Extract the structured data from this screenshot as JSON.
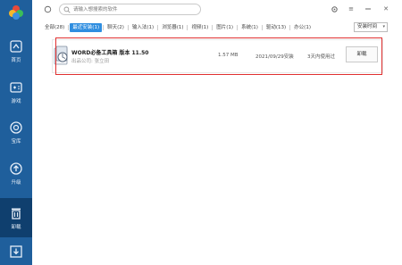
{
  "search": {
    "placeholder": "请输入想搜索的软件"
  },
  "sidebar": {
    "items": [
      {
        "label": "首页"
      },
      {
        "label": "游戏"
      },
      {
        "label": "宝库"
      },
      {
        "label": "升级"
      },
      {
        "label": "卸载"
      }
    ]
  },
  "window": {
    "menu_symbol": "≡",
    "close_symbol": "✕"
  },
  "tabs": [
    {
      "label": "全部(28)"
    },
    {
      "label": "最近安装(1)"
    },
    {
      "label": "聊天(2)"
    },
    {
      "label": "输入法(1)"
    },
    {
      "label": "浏览器(1)"
    },
    {
      "label": "视频(1)"
    },
    {
      "label": "图片(1)"
    },
    {
      "label": "系统(1)"
    },
    {
      "label": "驱动(13)"
    },
    {
      "label": "办公(1)"
    }
  ],
  "sort": {
    "label": "安装时间",
    "caret": "▾"
  },
  "app": {
    "name": "WORD必备工具箱 版本 11.50",
    "publisher": "出品公司: 张立田",
    "size": "1.57 MB",
    "install_date": "2021/09/29安装",
    "usage": "3天内使用过",
    "uninstall_label": "卸载"
  },
  "colors": {
    "sidebar": "#1f5f9c",
    "sidebar_active": "#0f3f6e",
    "accent": "#2f8ee0",
    "highlight": "#e03030"
  }
}
